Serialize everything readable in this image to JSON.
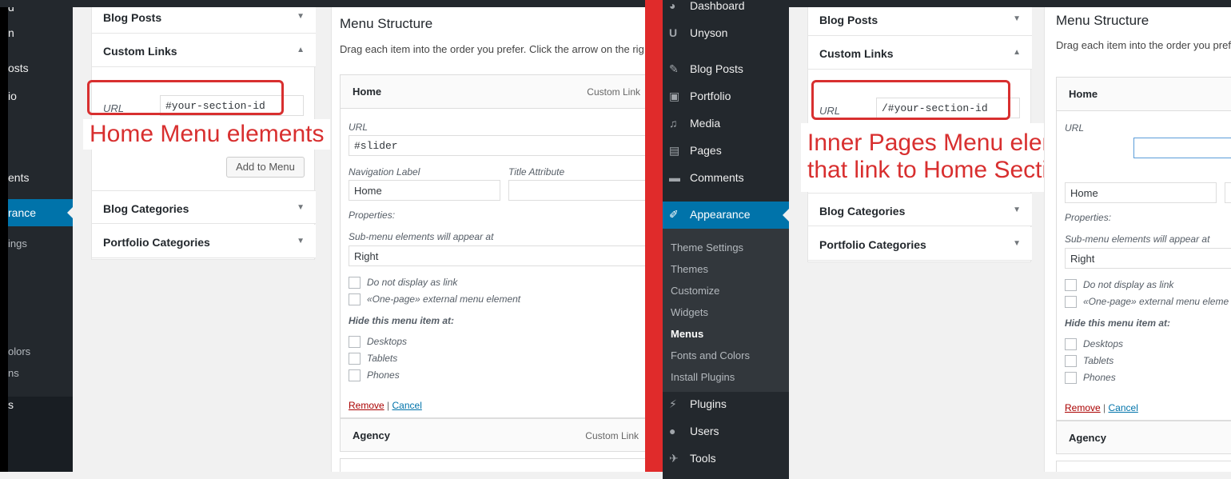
{
  "left": {
    "sidebar_fragments": [
      "d",
      "n",
      "osts",
      "io",
      "ents",
      "rance",
      "ings",
      "olors",
      "ns",
      "s"
    ],
    "accordion": {
      "blog_posts": "Blog Posts",
      "custom_links": "Custom Links",
      "blog_categories": "Blog Categories",
      "portfolio_categories": "Portfolio Categories"
    },
    "url_label": "URL",
    "url_value": "#your-section-id",
    "add_to_menu": "Add to Menu",
    "annotation": "Home Menu elements",
    "menu_structure": {
      "title": "Menu Structure",
      "subtitle": "Drag each item into the order you prefer. Click the arrow on the rig",
      "item_home": "Home",
      "item_home_type": "Custom Link",
      "url_label": "URL",
      "url_value": "#slider",
      "nav_label": "Navigation Label",
      "nav_value": "Home",
      "title_attr": "Title Attribute",
      "properties": "Properties:",
      "submenu_label": "Sub-menu elements will appear at",
      "submenu_value": "Right",
      "cb_no_link": "Do not display as link",
      "cb_onepage": "«One-page» external menu element",
      "hide_label": "Hide this menu item at:",
      "cb_desktops": "Desktops",
      "cb_tablets": "Tablets",
      "cb_phones": "Phones",
      "remove": "Remove",
      "separator": "|",
      "cancel": "Cancel",
      "item_agency": "Agency",
      "item_agency_type": "Custom Link"
    }
  },
  "right": {
    "sidebar": {
      "dashboard": "Dashboard",
      "unyson": "Unyson",
      "blog_posts": "Blog Posts",
      "portfolio": "Portfolio",
      "media": "Media",
      "pages": "Pages",
      "comments": "Comments",
      "appearance": "Appearance",
      "theme_settings": "Theme Settings",
      "themes": "Themes",
      "customize": "Customize",
      "widgets": "Widgets",
      "menus": "Menus",
      "fonts_colors": "Fonts and Colors",
      "install_plugins": "Install Plugins",
      "plugins": "Plugins",
      "users": "Users",
      "tools": "Tools"
    },
    "accordion": {
      "blog_posts": "Blog Posts",
      "custom_links": "Custom Links",
      "blog_categories": "Blog Categories",
      "portfolio_categories": "Portfolio Categories"
    },
    "url_label": "URL",
    "url_value": "/#your-section-id",
    "annotation_line1": "Inner Pages Menu elements",
    "annotation_line2": "that link to Home Sections",
    "menu_structure": {
      "title": "Menu Structure",
      "subtitle": "Drag each item into the order you pref",
      "item_home": "Home",
      "url_label": "URL",
      "nav_value": "Home",
      "properties": "Properties:",
      "submenu_label": "Sub-menu elements will appear at",
      "submenu_value": "Right",
      "cb_no_link": "Do not display as link",
      "cb_onepage": "«One-page» external menu eleme",
      "hide_label": "Hide this menu item at:",
      "cb_desktops": "Desktops",
      "cb_tablets": "Tablets",
      "cb_phones": "Phones",
      "remove": "Remove",
      "separator": "|",
      "cancel": "Cancel",
      "item_agency": "Agency"
    }
  },
  "colors": {
    "admin_bg": "#23282d",
    "accent": "#0073aa",
    "annotation_red": "#d82f2f"
  }
}
